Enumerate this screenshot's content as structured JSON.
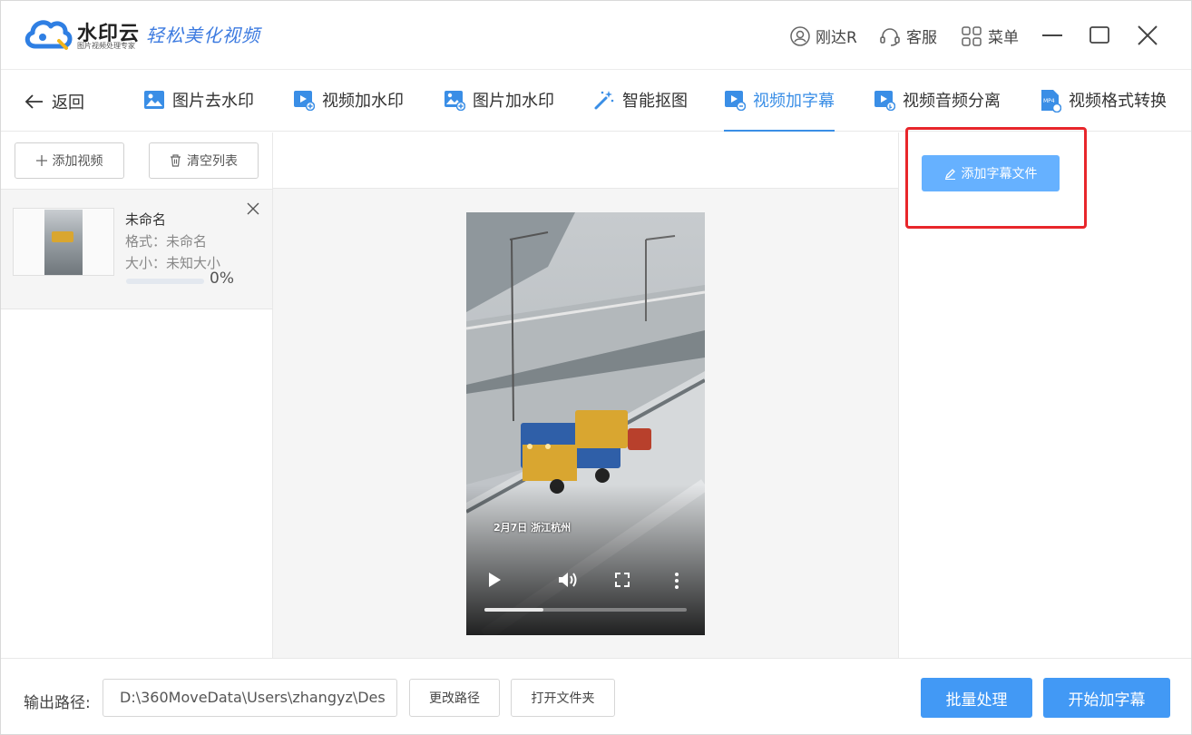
{
  "app": {
    "brand_name": "水印云",
    "brand_sub": "图片视频处理专家",
    "slogan": "轻松美化视频",
    "user_label": "刚达R",
    "service_label": "客服",
    "menu_label": "菜单"
  },
  "tabs": {
    "back_label": "返回",
    "items": [
      {
        "label": "图片去水印",
        "icon": "image-icon"
      },
      {
        "label": "视频加水印",
        "icon": "video-add-icon"
      },
      {
        "label": "图片加水印",
        "icon": "image-add-icon"
      },
      {
        "label": "智能抠图",
        "icon": "magic-wand-icon"
      },
      {
        "label": "视频加字幕",
        "icon": "video-subtitle-icon",
        "active": true
      },
      {
        "label": "视频音频分离",
        "icon": "video-audio-icon"
      },
      {
        "label": "视频格式转换",
        "icon": "mp4-file-icon"
      }
    ]
  },
  "left": {
    "add_video_label": "添加视频",
    "clear_list_label": "清空列表",
    "file": {
      "name": "未命名",
      "format": "格式：未命名",
      "size": "大小：未知大小",
      "progress": 0,
      "progress_text": "0%"
    }
  },
  "video": {
    "caption": "2月7日  浙江杭州",
    "playback_progress": 0.29
  },
  "right": {
    "add_subtitle_label": "添加字幕文件"
  },
  "bottom": {
    "output_label": "输出路径:",
    "output_path": "D:\\360MoveData\\Users\\zhangyz\\Des",
    "change_path_label": "更改路径",
    "open_folder_label": "打开文件夹",
    "batch_label": "批量处理",
    "start_label": "开始加字幕"
  },
  "colors": {
    "accent": "#3a8ee6",
    "primary_button": "#4299f5",
    "subtitle_button": "#66b1ff",
    "highlight": "#e8262b"
  }
}
